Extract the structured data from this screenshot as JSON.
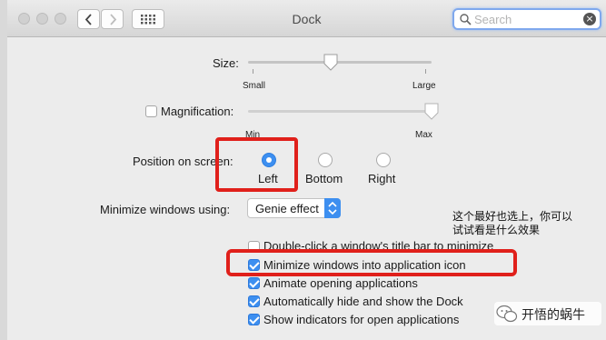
{
  "window": {
    "title": "Dock",
    "search_placeholder": "Search"
  },
  "size": {
    "label": "Size:",
    "min_label": "Small",
    "max_label": "Large",
    "value_fraction": 0.45
  },
  "magnification": {
    "label": "Magnification:",
    "checked": false,
    "min_label": "Min",
    "max_label": "Max",
    "value_fraction": 1.0
  },
  "position": {
    "label": "Position on screen:",
    "options": [
      {
        "label": "Left",
        "selected": true
      },
      {
        "label": "Bottom",
        "selected": false
      },
      {
        "label": "Right",
        "selected": false
      }
    ]
  },
  "minimize": {
    "label": "Minimize windows using:",
    "value": "Genie effect"
  },
  "checkboxes": [
    {
      "label": "Double-click a window's title bar to minimize",
      "checked": false
    },
    {
      "label": "Minimize windows into application icon",
      "checked": true
    },
    {
      "label": "Animate opening applications",
      "checked": true
    },
    {
      "label": "Automatically hide and show the Dock",
      "checked": true
    },
    {
      "label": "Show indicators for open applications",
      "checked": true
    }
  ],
  "annotation": {
    "line1": "这个最好也选上，你可以",
    "line2": "试试看是什么效果"
  },
  "watermark": {
    "text": "开悟的蜗牛"
  },
  "colors": {
    "accent": "#3d8ff0",
    "highlight_box": "#e0201b"
  }
}
